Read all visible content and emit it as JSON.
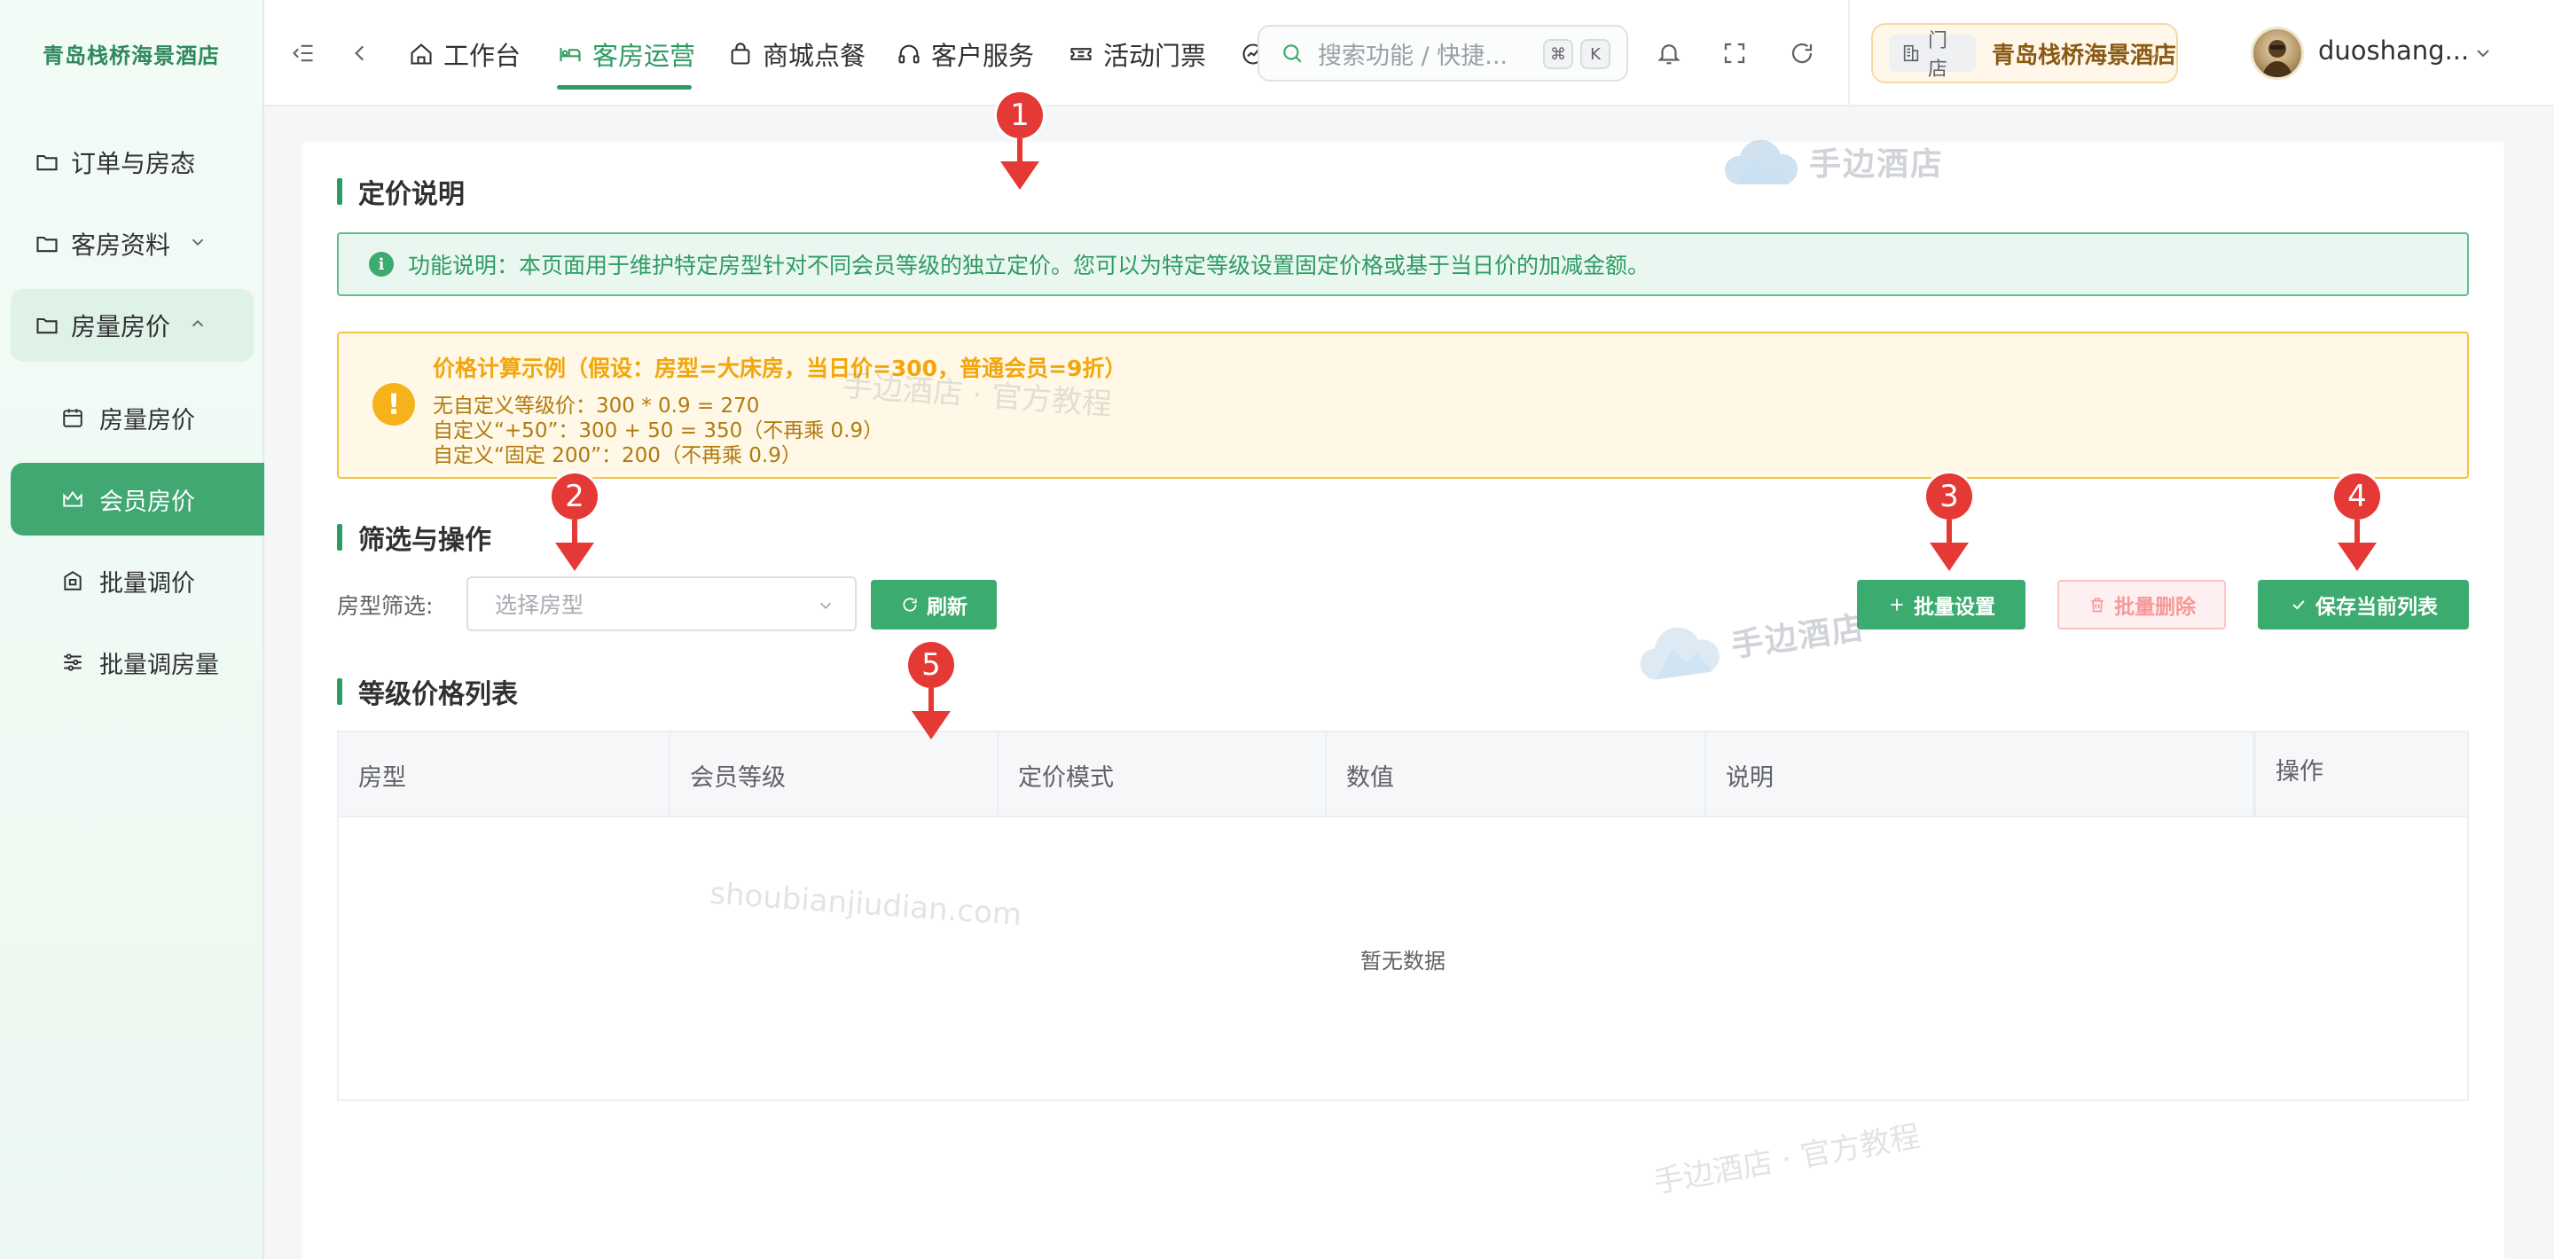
{
  "brand": {
    "name": "青岛栈桥海景酒店"
  },
  "sidebar": {
    "items": [
      {
        "label": "订单与房态",
        "icon": "folder-icon"
      },
      {
        "label": "客房资料",
        "icon": "folder-icon"
      },
      {
        "label": "房量房价",
        "icon": "folder-icon"
      }
    ],
    "subitems": [
      {
        "label": "房量房价",
        "icon": "calendar-icon"
      },
      {
        "label": "会员房价",
        "icon": "crown-icon"
      },
      {
        "label": "批量调价",
        "icon": "building-icon"
      },
      {
        "label": "批量调房量",
        "icon": "sliders-icon"
      }
    ]
  },
  "header": {
    "tabs": [
      {
        "label": "工作台",
        "icon": "home-icon"
      },
      {
        "label": "客房运营",
        "icon": "bed-icon"
      },
      {
        "label": "商城点餐",
        "icon": "bag-icon"
      },
      {
        "label": "客户服务",
        "icon": "headset-icon"
      },
      {
        "label": "活动门票",
        "icon": "ticket-icon"
      }
    ],
    "search_placeholder": "搜索功能 / 快捷...",
    "kbd": [
      "⌘",
      "K"
    ],
    "store_tag": "门店",
    "store_name": "青岛栈桥海景酒店",
    "user_name": "duoshang..."
  },
  "pricing": {
    "title": "定价说明",
    "info": "功能说明：本页面用于维护特定房型针对不同会员等级的独立定价。您可以为特定等级设置固定价格或基于当日价的加减金额。",
    "warn_title": "价格计算示例（假设：房型=大床房，当日价=300，普通会员=9折）",
    "warn_lines": [
      "无自定义等级价：300 * 0.9 = 270",
      "自定义“+50”：300 + 50 = 350（不再乘 0.9）",
      "自定义“固定 200”：200（不再乘 0.9）"
    ]
  },
  "filter": {
    "title": "筛选与操作",
    "label": "房型筛选:",
    "placeholder": "选择房型",
    "refresh": "刷新",
    "batch_set": "批量设置",
    "batch_delete": "批量删除",
    "save": "保存当前列表"
  },
  "table": {
    "title": "等级价格列表",
    "columns": [
      "房型",
      "会员等级",
      "定价模式",
      "数值",
      "说明",
      "操作"
    ],
    "empty": "暂无数据"
  },
  "markers": [
    "1",
    "2",
    "3",
    "4",
    "5"
  ],
  "watermarks": {
    "logo_text": "手边酒店",
    "tutorial": "手边酒店 · 官方教程",
    "url": "shoubianjiudian.com"
  },
  "colors": {
    "accent": "#2e9b63",
    "warn": "#f6b21b",
    "marker": "#e53935"
  }
}
